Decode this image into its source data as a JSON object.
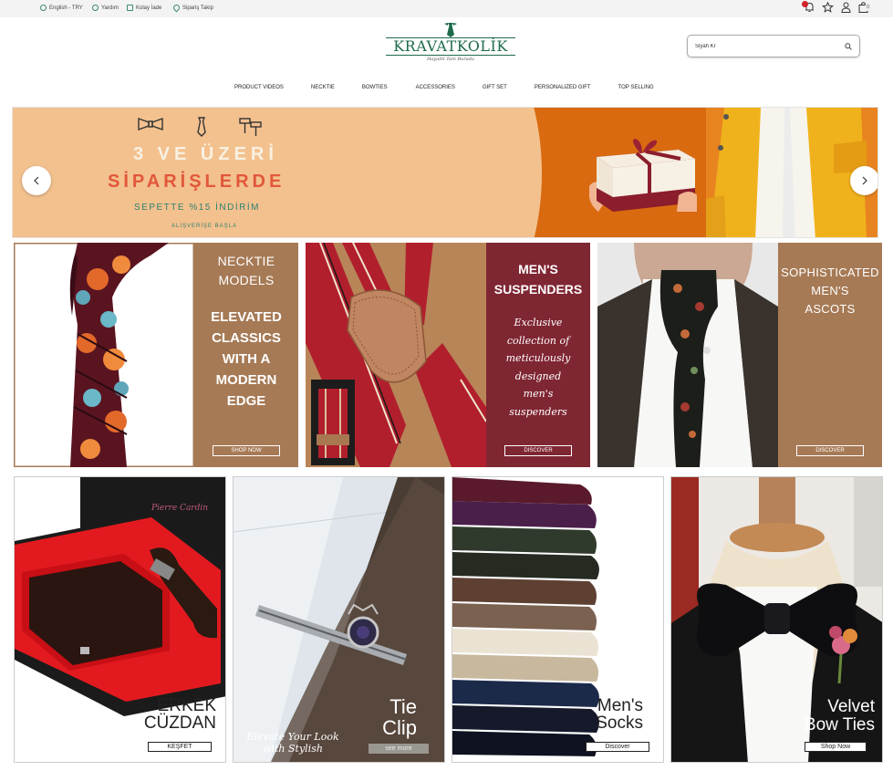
{
  "topbar": {
    "language": "English - TRY",
    "help": "Yardım",
    "easy_return": "Kolay İade",
    "order_tracking": "Sipariş Takip",
    "cart_count": "0"
  },
  "header": {
    "brand": "KRAVATKOLİK",
    "tagline": "Hayalin Tam Burada",
    "search_value": "Siyah Kr"
  },
  "nav": [
    "PRODUCT VIDEOS",
    "NECKTIE",
    "BOWTIES",
    "ACCESSORIES",
    "GIFT SET",
    "PERSONALIZED GIFT",
    "TOP SELLING"
  ],
  "hero": {
    "line1": "3 VE ÜZERİ",
    "line2": "SİPARİŞLERDE",
    "line3": "SEPETTE %15 İNDİRİM",
    "line4": "ALIŞVERİŞE BAŞLA"
  },
  "categories": {
    "necktie": {
      "title": [
        "NECKTIE",
        "MODELS"
      ],
      "headline": [
        "ELEVATED",
        "CLASSICS",
        "WITH A",
        "MODERN",
        "EDGE"
      ],
      "button": "SHOP NOW"
    },
    "suspenders": {
      "title": [
        "MEN'S",
        "SUSPENDERS"
      ],
      "script": [
        "Exclusive",
        "collection of",
        "meticulously",
        "designed",
        "men's",
        "suspenders"
      ],
      "button": "DISCOVER"
    },
    "ascots": {
      "title": [
        "SOPHISTICATED",
        "MEN'S",
        "ASCOTS"
      ],
      "button": "DISCOVER"
    }
  },
  "products": {
    "wallet": {
      "caption": [
        "ERKEK",
        "CÜZDAN"
      ],
      "button": "KEŞFET",
      "box_logo": "Pierre Cardin"
    },
    "tieclip": {
      "caption": [
        "Tie",
        "Clip"
      ],
      "script": [
        "Elevate Your Look",
        "with Stylish"
      ],
      "button": "see more"
    },
    "socks": {
      "caption": [
        "Men's",
        "Socks"
      ],
      "button": "Discover"
    },
    "bowtie": {
      "caption": [
        "Velvet",
        "Bow Ties"
      ],
      "button": "Shop Now"
    }
  },
  "colors": {
    "brand_green": "#1d6b4a",
    "tan_panel": "#a67a55",
    "burgundy_panel": "#7f2633",
    "hero_orange": "#d96a10",
    "hero_peach": "#f3c18e"
  }
}
